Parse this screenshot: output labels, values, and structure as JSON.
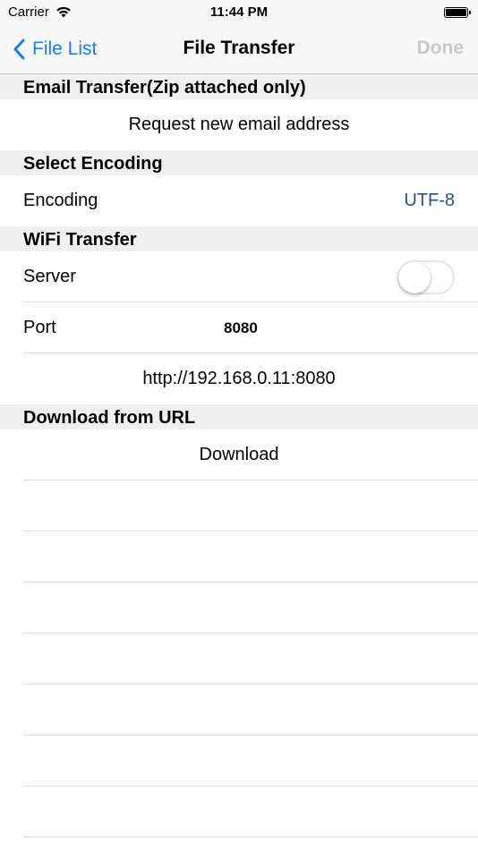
{
  "status_bar": {
    "carrier": "Carrier",
    "time": "11:44 PM"
  },
  "nav": {
    "back_label": "File List",
    "title": "File Transfer",
    "done_label": "Done"
  },
  "sections": {
    "email": {
      "header": "Email Transfer(Zip attached only)",
      "request_label": "Request new email address"
    },
    "encoding": {
      "header": "Select Encoding",
      "label": "Encoding",
      "value": "UTF-8"
    },
    "wifi": {
      "header": "WiFi Transfer",
      "server_label": "Server",
      "server_on": false,
      "port_label": "Port",
      "port_value": "8080",
      "address": "http://192.168.0.11:8080"
    },
    "download": {
      "header": "Download from URL",
      "button_label": "Download"
    }
  },
  "colors": {
    "tint": "#1b7cf6",
    "value_blue": "#2c4f8c",
    "disabled": "#c7c7cc"
  }
}
